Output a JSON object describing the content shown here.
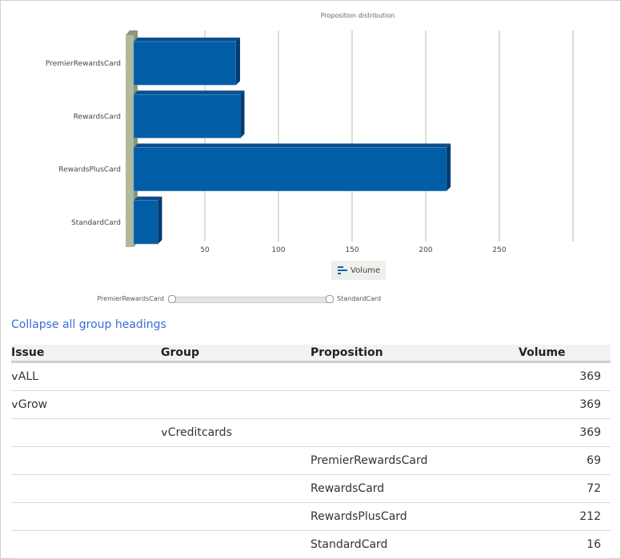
{
  "chart_data": {
    "type": "bar",
    "orientation": "horizontal",
    "title": "Proposition distribution",
    "categories": [
      "PremierRewardsCard",
      "RewardsCard",
      "RewardsPlusCard",
      "StandardCard"
    ],
    "series": [
      {
        "name": "Volume",
        "values": [
          69,
          72,
          212,
          16
        ],
        "color": "#005da6"
      }
    ],
    "xlabel": "",
    "ylabel": "",
    "xlim": [
      0,
      300
    ],
    "x_ticks": [
      50,
      100,
      150,
      200,
      250
    ],
    "grid": true,
    "legend": "bottom-center",
    "colors": {
      "bar": "#005da6",
      "bar_top": "#0a4f8c",
      "bar_side": "#003b6f",
      "wall": "#b0bb9c",
      "wall_dark": "#8b9577",
      "grid": "#b8c0a8"
    }
  },
  "range_selector": {
    "start_label": "PremierRewardsCard",
    "end_label": "StandardCard"
  },
  "collapse_link": "Collapse all group headings",
  "table": {
    "headers": {
      "issue": "Issue",
      "group": "Group",
      "proposition": "Proposition",
      "volume": "Volume"
    },
    "rows": [
      {
        "issue": "ALL",
        "group": "",
        "proposition": "",
        "volume": "369",
        "level": 0
      },
      {
        "issue": "Grow",
        "group": "",
        "proposition": "",
        "volume": "369",
        "level": 0
      },
      {
        "issue": "",
        "group": "Creditcards",
        "proposition": "",
        "volume": "369",
        "level": 1
      },
      {
        "issue": "",
        "group": "",
        "proposition": "PremierRewardsCard",
        "volume": "69",
        "level": 2
      },
      {
        "issue": "",
        "group": "",
        "proposition": "RewardsCard",
        "volume": "72",
        "level": 2
      },
      {
        "issue": "",
        "group": "",
        "proposition": "RewardsPlusCard",
        "volume": "212",
        "level": 2
      },
      {
        "issue": "",
        "group": "",
        "proposition": "StandardCard",
        "volume": "16",
        "level": 2
      }
    ]
  },
  "icons": {
    "expand": "chevron-down-icon",
    "legend": "bar-chart-icon"
  }
}
